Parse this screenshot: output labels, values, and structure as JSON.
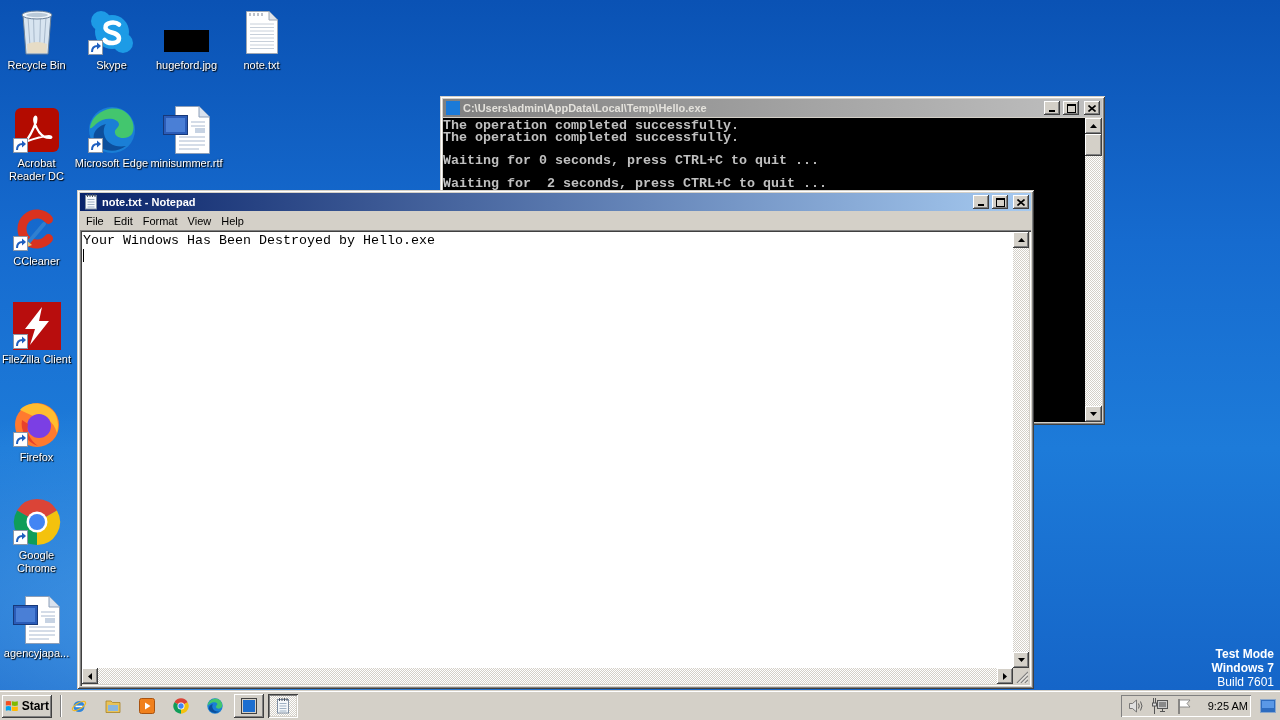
{
  "desktop": {
    "icon_columns": [
      [
        {
          "label": "Recycle Bin",
          "kind": "recycle-bin",
          "shortcut": false
        },
        {
          "label": "Acrobat Reader DC",
          "kind": "pdf-reader",
          "shortcut": true
        },
        {
          "label": "CCleaner",
          "kind": "cleaner",
          "shortcut": true
        },
        {
          "label": "FileZilla Client",
          "kind": "ftp-client",
          "shortcut": true
        },
        {
          "label": "Firefox",
          "kind": "firefox",
          "shortcut": true
        },
        {
          "label": "Google Chrome",
          "kind": "chrome",
          "shortcut": true
        },
        {
          "label": "agencyjapa...",
          "kind": "word-document",
          "shortcut": false
        }
      ],
      [
        {
          "label": "Skype",
          "kind": "skype",
          "shortcut": true
        },
        {
          "label": "Microsoft Edge",
          "kind": "edge",
          "shortcut": true
        }
      ],
      [
        {
          "label": "hugeford.jpg",
          "kind": "image",
          "shortcut": false
        },
        {
          "label": "minisummer.rtf",
          "kind": "word-document",
          "shortcut": false
        }
      ],
      [
        {
          "label": "note.txt",
          "kind": "text-file",
          "shortcut": false
        }
      ]
    ],
    "system_notice": [
      {
        "text": "Test Mode",
        "bold": true
      },
      {
        "text": "Windows 7",
        "bold": true
      },
      {
        "text": "Build 7601",
        "bold": false
      }
    ]
  },
  "console_window": {
    "title": "C:\\Users\\admin\\AppData\\Local\\Temp\\Hello.exe",
    "active": false,
    "output_blocks": [
      [
        "The operation completed successfully.",
        "The operation completed successfully."
      ],
      [
        "Waiting for 0 seconds, press CTRL+C to quit ..."
      ],
      [
        "Waiting for  2 seconds, press CTRL+C to quit ..."
      ]
    ]
  },
  "notepad_window": {
    "title": "note.txt - Notepad",
    "active": true,
    "menu": [
      "File",
      "Edit",
      "Format",
      "View",
      "Help"
    ],
    "text": "Your Windows Has Been Destroyed by Hello.exe"
  },
  "taskbar": {
    "start_label": "Start",
    "quick_launch": [
      {
        "kind": "ie"
      },
      {
        "kind": "explorer"
      },
      {
        "kind": "media-player"
      },
      {
        "kind": "chrome"
      },
      {
        "kind": "edge"
      }
    ],
    "tasks": [
      {
        "kind": "console",
        "selected": false
      },
      {
        "kind": "notepad",
        "selected": true
      }
    ],
    "clock": "9:25 AM"
  }
}
